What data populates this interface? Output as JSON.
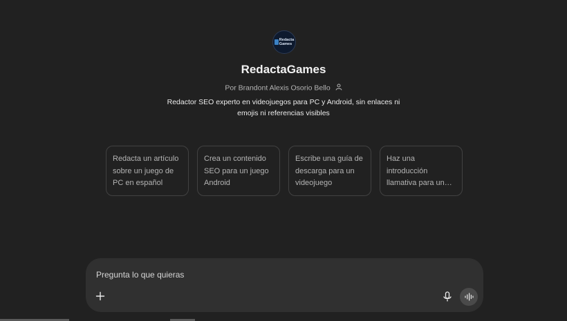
{
  "gpt": {
    "name": "RedactaGames",
    "author": "Por Brandont Alexis Osorio Bello",
    "description": "Redactor SEO experto en videojuegos para PC y Android, sin enlaces ni emojis ni referencias visibles",
    "logo_text_line1": "Redacta",
    "logo_text_line2": "Games",
    "author_icon": "user-icon"
  },
  "conversation_starters": [
    {
      "label": "Redacta un artículo sobre un juego de PC en español"
    },
    {
      "label": "Crea un contenido SEO para un juego Android"
    },
    {
      "label": "Escribe una guía de descarga para un videojuego"
    },
    {
      "label": "Haz una introducción llamativa para un…"
    }
  ],
  "composer": {
    "placeholder": "Pregunta lo que quieras",
    "icons": [
      "plus-icon",
      "microphone-icon",
      "voice-mode-icon"
    ]
  },
  "colors": {
    "background": "#212121",
    "composer_bg": "#303030",
    "card_border": "#424242"
  }
}
